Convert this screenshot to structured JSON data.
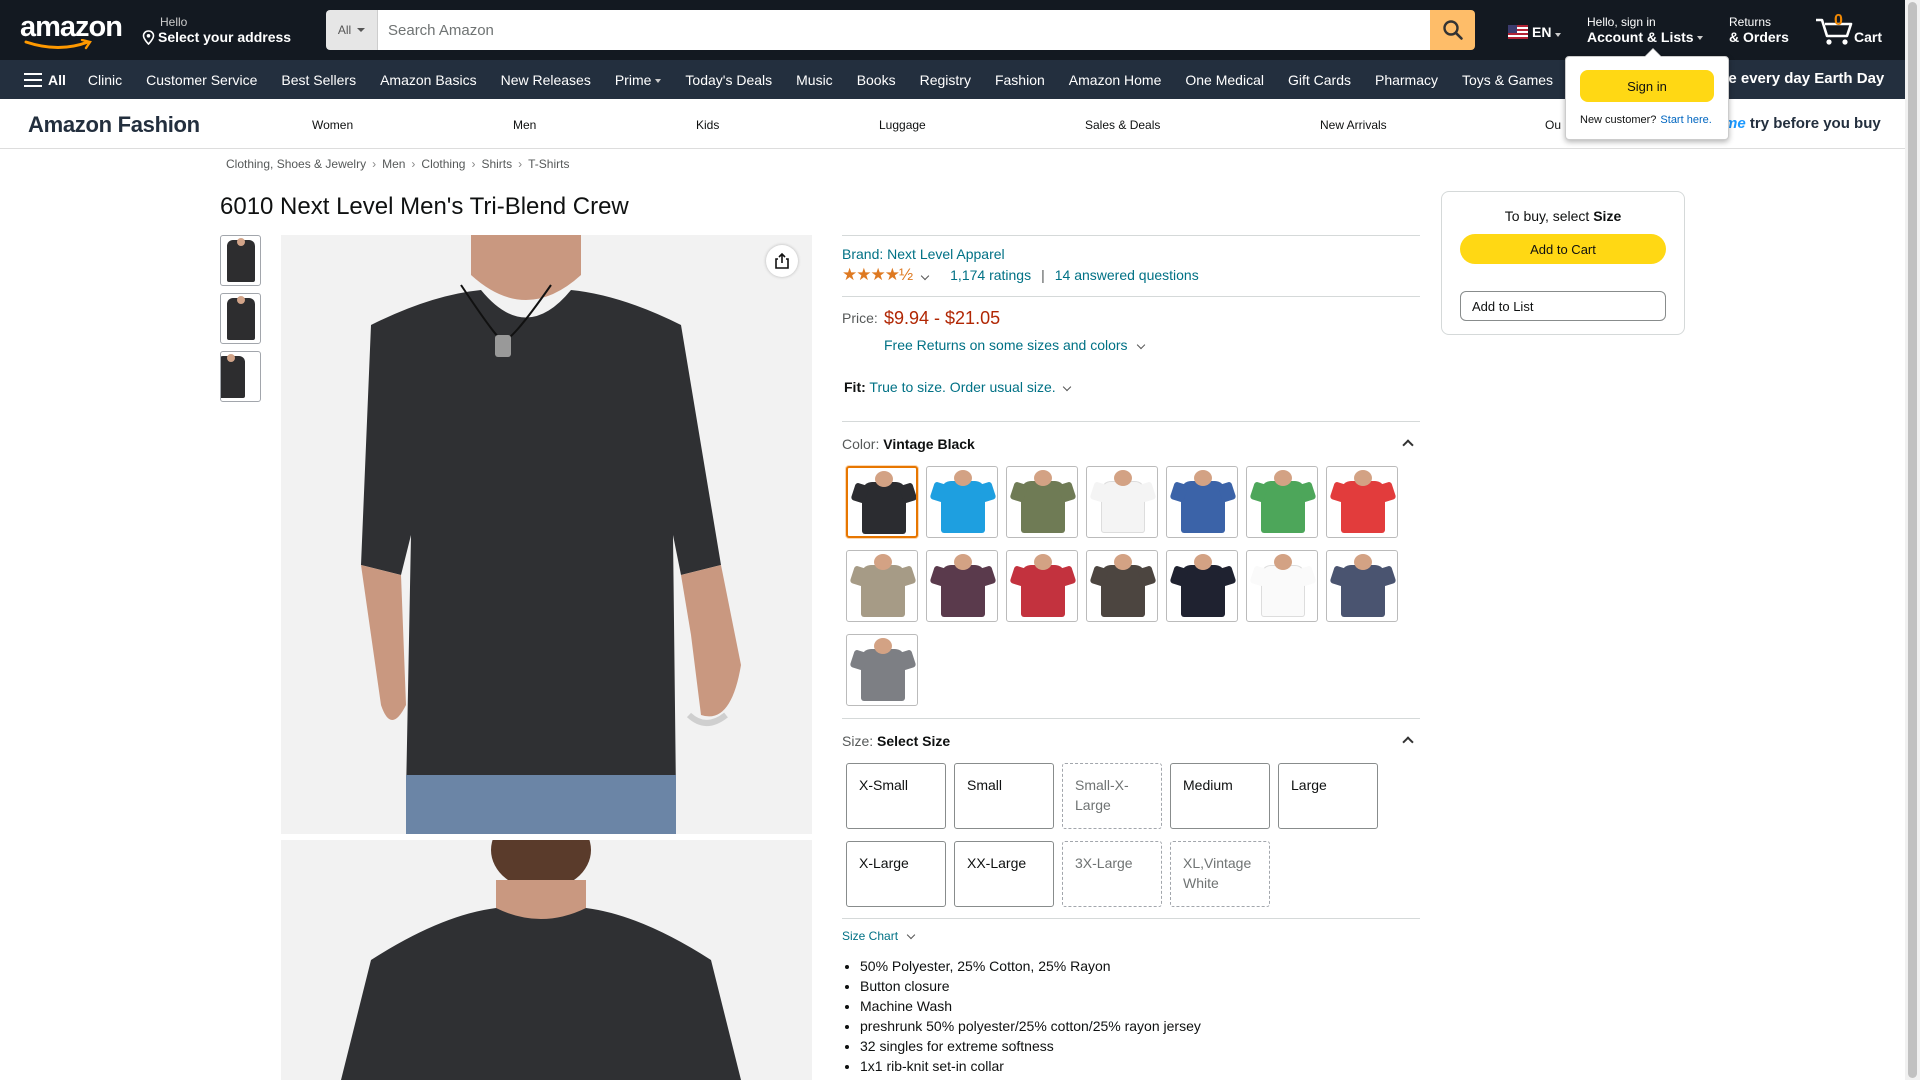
{
  "header": {
    "logo_text": "amazon",
    "address": {
      "line1": "Hello",
      "line2": "Select your address"
    },
    "search": {
      "category": "All",
      "placeholder": "Search Amazon"
    },
    "language": "EN",
    "account": {
      "line1": "Hello, sign in",
      "line2": "Account & Lists"
    },
    "returns": {
      "line1": "Returns",
      "line2": "& Orders"
    },
    "cart": {
      "count": "0",
      "label": "Cart"
    }
  },
  "nav": {
    "all_label": "All",
    "items": [
      "Clinic",
      "Customer Service",
      "Best Sellers",
      "Amazon Basics",
      "New Releases",
      "Prime",
      "Today's Deals",
      "Music",
      "Books",
      "Registry",
      "Fashion",
      "Amazon Home",
      "One Medical",
      "Gift Cards",
      "Pharmacy",
      "Toys & Games"
    ],
    "promo": "ke every day Earth Day"
  },
  "fashion_bar": {
    "logo": "Amazon Fashion",
    "items": [
      "Women",
      "Men",
      "Kids",
      "Luggage",
      "Sales & Deals",
      "New Arrivals",
      "Ou"
    ],
    "prime_try_me": "me",
    "prime_try_rest": " try before you buy"
  },
  "popover": {
    "signin_label": "Sign in",
    "new_customer": "New customer?",
    "start_here": "Start here."
  },
  "breadcrumb": [
    "Clothing, Shoes & Jewelry",
    "Men",
    "Clothing",
    "Shirts",
    "T-Shirts"
  ],
  "product": {
    "title": "6010 Next Level Men's Tri-Blend Crew",
    "brand": "Brand: Next Level Apparel",
    "ratings": "1,174 ratings",
    "separator": "|",
    "answered": "14 answered questions",
    "stars_glyph": "★★★★½",
    "price_label": "Price:",
    "price": "$9.94 - $21.05",
    "returns": "Free Returns on some sizes and colors",
    "fit_label": "Fit:",
    "fit_value": "True to size. Order usual size."
  },
  "color": {
    "label": "Color:",
    "selected": "Vintage Black",
    "swatches": [
      {
        "color": "#2b2c30",
        "selected": true
      },
      {
        "color": "#1e9fe0"
      },
      {
        "color": "#6f7b55"
      },
      {
        "color": "#f4f4f4"
      },
      {
        "color": "#3b63a8"
      },
      {
        "color": "#4da65a"
      },
      {
        "color": "#e23c3c"
      },
      {
        "color": "#a69b86"
      },
      {
        "color": "#5a3a4c"
      },
      {
        "color": "#c3323e"
      },
      {
        "color": "#4c4540"
      },
      {
        "color": "#1f2230"
      },
      {
        "color": "#fafafa"
      },
      {
        "color": "#4a5470"
      },
      {
        "color": "#7d7f84"
      }
    ]
  },
  "size": {
    "label": "Size:",
    "selected": "Select Size",
    "options": [
      {
        "label": "X-Small",
        "available": true
      },
      {
        "label": "Small",
        "available": true
      },
      {
        "label": "Small-X-Large",
        "available": false
      },
      {
        "label": "Medium",
        "available": true
      },
      {
        "label": "Large",
        "available": true
      },
      {
        "label": "X-Large",
        "available": true
      },
      {
        "label": "XX-Large",
        "available": true
      },
      {
        "label": "3X-Large",
        "available": false
      },
      {
        "label": "XL,Vintage White",
        "available": false
      }
    ]
  },
  "size_chart": "Size Chart",
  "bullets": [
    "50% Polyester, 25% Cotton, 25% Rayon",
    "Button closure",
    "Machine Wash",
    "preshrunk 50% polyester/25% cotton/25% rayon jersey",
    "32 singles for extreme softness",
    "1x1 rib-knit set-in collar"
  ],
  "buybox": {
    "to_buy": "To buy, select",
    "to_buy_bold": "Size",
    "add_to_cart": "Add to Cart",
    "add_to_list": "Add to List"
  }
}
